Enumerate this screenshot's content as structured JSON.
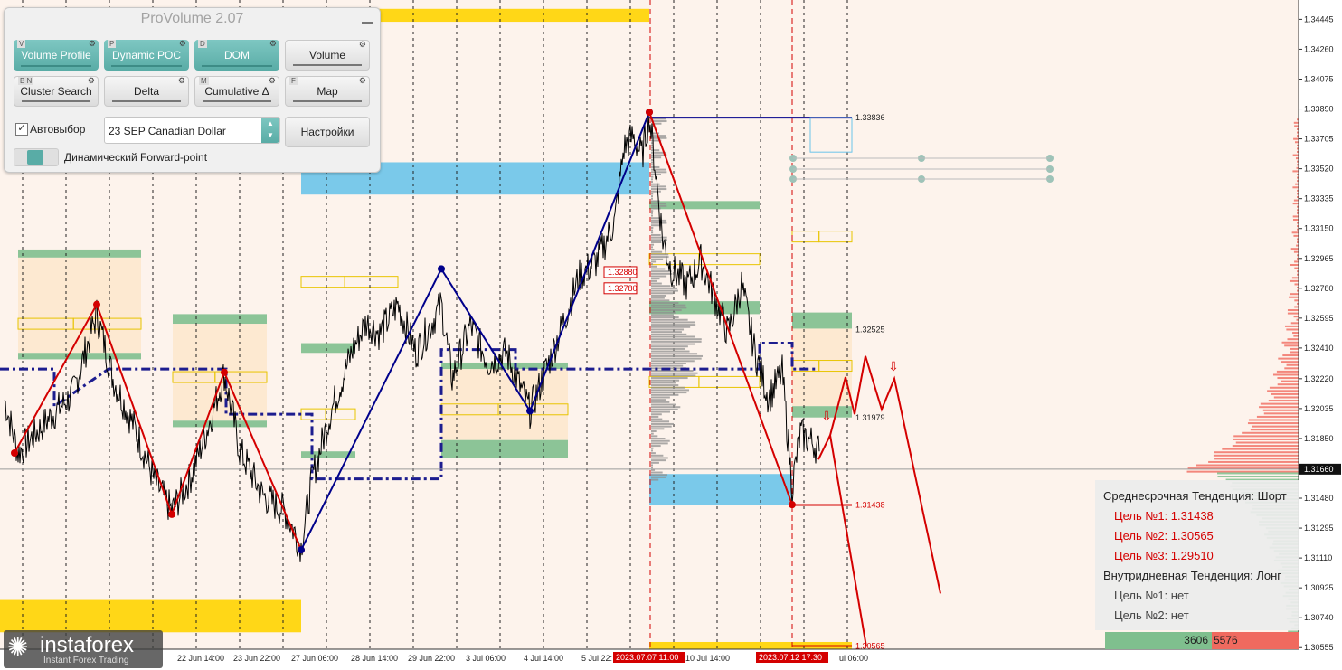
{
  "panel": {
    "title": "ProVolume 2.07",
    "buttons": [
      {
        "key": "V",
        "label": "Volume Profile",
        "style": "teal"
      },
      {
        "key": "P",
        "label": "Dynamic POC",
        "style": "teal"
      },
      {
        "key": "D",
        "label": "DOM",
        "style": "teal"
      },
      {
        "key": "",
        "label": "Volume",
        "style": "gray"
      },
      {
        "key": "B N",
        "label": "Cluster Search",
        "style": "gray"
      },
      {
        "key": "",
        "label": "Delta",
        "style": "gray"
      },
      {
        "key": "M",
        "label": "Cumulative Δ",
        "style": "gray"
      },
      {
        "key": "F",
        "label": "Map",
        "style": "gray"
      }
    ],
    "autoselect_label": "Автовыбор",
    "symbol": "23 SEP Canadian Dollar",
    "settings_label": "Настройки",
    "forward_label": "Динамический Forward-point"
  },
  "info": {
    "mid_title": "Среднесрочная Тенденция: Шорт",
    "mid_targets": [
      "Цель №1: 1.31438",
      "Цель №2: 1.30565",
      "Цель №3: 1.29510"
    ],
    "intra_title": "Внутридневная Тенденция: Лонг",
    "intra_targets": [
      "Цель №1: нет",
      "Цель №2: нет"
    ]
  },
  "volume_bar": {
    "buy": "3606",
    "sell": "5576"
  },
  "logo": {
    "name": "instaforex",
    "sub": "Instant Forex Trading"
  },
  "colors": {
    "background": "#fdf3ec",
    "bull_zone": "#7fbf8e",
    "bear_zone": "#f06a5f",
    "blue_zone": "#6cc4ea",
    "yellow_zone": "#ffd400",
    "zigzag_red": "#d40000",
    "zigzag_blue": "#00008b",
    "dash_level": "#1d1d8f"
  },
  "chart_data": {
    "type": "line",
    "symbol": "23 SEP Canadian Dollar",
    "y_ticks": [
      "1.34445",
      "1.34260",
      "1.34075",
      "1.33890",
      "1.33705",
      "1.33520",
      "1.33335",
      "1.33150",
      "1.32965",
      "1.32780",
      "1.32595",
      "1.32410",
      "1.32220",
      "1.32035",
      "1.31850",
      "1.31660",
      "1.31480",
      "1.31295",
      "1.31110",
      "1.30925",
      "1.30740",
      "1.30555"
    ],
    "ylim": [
      1.3045,
      1.3452
    ],
    "x_labels": [
      "22 Jun 14:00",
      "23 Jun 22:00",
      "27 Jun 06:00",
      "28 Jun 14:00",
      "29 Jun 22:00",
      "3 Jul 06:00",
      "4 Jul 14:00",
      "5 Jul 22:",
      "10 Jul 14:00",
      "ul 06:00"
    ],
    "current_price": "1.31660",
    "price_levels": [
      {
        "label": "1.33836",
        "value": 1.33836
      },
      {
        "label": "1.32525",
        "value": 1.32525
      },
      {
        "label": "1.31979",
        "value": 1.31979
      },
      {
        "label": "1.31438",
        "value": 1.31438
      },
      {
        "label": "1.30565",
        "value": 1.30565
      },
      {
        "label": "1.32880",
        "value": 1.3288
      },
      {
        "label": "1.32780",
        "value": 1.3278
      }
    ],
    "time_markers": [
      "2023.07.07 11:00",
      "2023.07.12 17:30"
    ],
    "zigzag_red": [
      {
        "t": 16,
        "p": 1.3176
      },
      {
        "t": 107,
        "p": 1.3268
      },
      {
        "t": 190,
        "p": 1.3138
      },
      {
        "t": 248,
        "p": 1.3226
      },
      {
        "t": 333,
        "p": 1.3116
      }
    ],
    "zigzag_blue": [
      {
        "t": 333,
        "p": 1.3116
      },
      {
        "t": 488,
        "p": 1.329
      },
      {
        "t": 586,
        "p": 1.3202
      },
      {
        "t": 718,
        "p": 1.3387
      }
    ],
    "zigzag_red_2": [
      {
        "t": 718,
        "p": 1.3387
      },
      {
        "t": 876,
        "p": 1.3144
      }
    ],
    "forecast": [
      {
        "t": 905,
        "p": 1.3172
      },
      {
        "t": 918,
        "p": 1.3187
      },
      {
        "t": 935,
        "p": 1.3223
      },
      {
        "t": 945,
        "p": 1.32
      },
      {
        "t": 957,
        "p": 1.3236
      },
      {
        "t": 975,
        "p": 1.3203
      },
      {
        "t": 989,
        "p": 1.3222
      },
      {
        "t": 1040,
        "p": 1.3089
      }
    ],
    "forecast_2": [
      {
        "t": 918,
        "p": 1.3187
      },
      {
        "t": 958,
        "p": 1.3056
      }
    ],
    "price_anchors": [
      {
        "t": 5,
        "p": 1.3209
      },
      {
        "t": 20,
        "p": 1.3176
      },
      {
        "t": 50,
        "p": 1.3195
      },
      {
        "t": 80,
        "p": 1.3212
      },
      {
        "t": 107,
        "p": 1.3262
      },
      {
        "t": 125,
        "p": 1.3222
      },
      {
        "t": 150,
        "p": 1.319
      },
      {
        "t": 170,
        "p": 1.316
      },
      {
        "t": 190,
        "p": 1.314
      },
      {
        "t": 210,
        "p": 1.316
      },
      {
        "t": 230,
        "p": 1.3192
      },
      {
        "t": 248,
        "p": 1.3225
      },
      {
        "t": 265,
        "p": 1.3178
      },
      {
        "t": 290,
        "p": 1.315
      },
      {
        "t": 315,
        "p": 1.314
      },
      {
        "t": 333,
        "p": 1.3118
      },
      {
        "t": 345,
        "p": 1.316
      },
      {
        "t": 365,
        "p": 1.32
      },
      {
        "t": 390,
        "p": 1.324
      },
      {
        "t": 405,
        "p": 1.3257
      },
      {
        "t": 420,
        "p": 1.325
      },
      {
        "t": 440,
        "p": 1.3268
      },
      {
        "t": 460,
        "p": 1.3238
      },
      {
        "t": 488,
        "p": 1.3268
      },
      {
        "t": 500,
        "p": 1.3222
      },
      {
        "t": 520,
        "p": 1.3255
      },
      {
        "t": 540,
        "p": 1.3232
      },
      {
        "t": 560,
        "p": 1.3238
      },
      {
        "t": 586,
        "p": 1.3202
      },
      {
        "t": 600,
        "p": 1.3222
      },
      {
        "t": 620,
        "p": 1.3252
      },
      {
        "t": 640,
        "p": 1.3285
      },
      {
        "t": 660,
        "p": 1.3295
      },
      {
        "t": 680,
        "p": 1.332
      },
      {
        "t": 690,
        "p": 1.3365
      },
      {
        "t": 700,
        "p": 1.3372
      },
      {
        "t": 710,
        "p": 1.336
      },
      {
        "t": 718,
        "p": 1.3385
      },
      {
        "t": 725,
        "p": 1.335
      },
      {
        "t": 733,
        "p": 1.3308
      },
      {
        "t": 742,
        "p": 1.329
      },
      {
        "t": 760,
        "p": 1.328
      },
      {
        "t": 775,
        "p": 1.3295
      },
      {
        "t": 790,
        "p": 1.3273
      },
      {
        "t": 805,
        "p": 1.325
      },
      {
        "t": 820,
        "p": 1.328
      },
      {
        "t": 835,
        "p": 1.3238
      },
      {
        "t": 850,
        "p": 1.321
      },
      {
        "t": 865,
        "p": 1.3226
      },
      {
        "t": 876,
        "p": 1.3155
      },
      {
        "t": 885,
        "p": 1.3188
      },
      {
        "t": 900,
        "p": 1.3182
      },
      {
        "t": 906,
        "p": 1.3177
      }
    ],
    "zones": [
      {
        "kind": "green",
        "x": [
          20,
          156
        ],
        "p": [
          1.3302,
          1.3297
        ]
      },
      {
        "kind": "band",
        "x": [
          20,
          156
        ],
        "p": [
          1.3297,
          1.3238
        ]
      },
      {
        "kind": "green",
        "x": [
          20,
          156
        ],
        "p": [
          1.3238,
          1.3234
        ]
      },
      {
        "kind": "green",
        "x": [
          191,
          295
        ],
        "p": [
          1.3262,
          1.3256
        ]
      },
      {
        "kind": "band",
        "x": [
          191,
          295
        ],
        "p": [
          1.3256,
          1.3196
        ]
      },
      {
        "kind": "green",
        "x": [
          191,
          295
        ],
        "p": [
          1.3196,
          1.3192
        ]
      },
      {
        "kind": "green",
        "x": [
          333,
          393
        ],
        "p": [
          1.3244,
          1.3238
        ]
      },
      {
        "kind": "green",
        "x": [
          333,
          393
        ],
        "p": [
          1.3177,
          1.3173
        ]
      },
      {
        "kind": "green",
        "x": [
          488,
          628
        ],
        "p": [
          1.3232,
          1.3228
        ]
      },
      {
        "kind": "band",
        "x": [
          488,
          628
        ],
        "p": [
          1.3228,
          1.3184
        ]
      },
      {
        "kind": "green",
        "x": [
          488,
          628
        ],
        "p": [
          1.3184,
          1.3173
        ]
      },
      {
        "kind": "blue",
        "x": [
          333,
          718
        ],
        "p": [
          1.3356,
          1.3336
        ]
      },
      {
        "kind": "yellow",
        "x": [
          333,
          718
        ],
        "p": [
          1.3451,
          1.3443
        ]
      },
      {
        "kind": "yellow",
        "x": [
          0,
          333
        ],
        "p": [
          1.3085,
          1.3065
        ]
      },
      {
        "kind": "green",
        "x": [
          718,
          840
        ],
        "p": [
          1.3332,
          1.3327
        ]
      },
      {
        "kind": "green",
        "x": [
          718,
          840
        ],
        "p": [
          1.327,
          1.3262
        ]
      },
      {
        "kind": "blue",
        "x": [
          718,
          876
        ],
        "p": [
          1.3163,
          1.3144
        ]
      },
      {
        "kind": "green",
        "x": [
          876,
          942
        ],
        "p": [
          1.3263,
          1.3253
        ]
      },
      {
        "kind": "band",
        "x": [
          876,
          942
        ],
        "p": [
          1.3253,
          1.3205
        ]
      },
      {
        "kind": "green",
        "x": [
          876,
          942
        ],
        "p": [
          1.3205,
          1.3198
        ]
      },
      {
        "kind": "yellow",
        "x": [
          718,
          942
        ],
        "p": [
          1.3059,
          1.3054
        ]
      }
    ],
    "poc_boxes": [
      {
        "x": [
          20,
          156
        ],
        "p": 1.3256
      },
      {
        "x": [
          191,
          295
        ],
        "p": 1.3223
      },
      {
        "x": [
          333,
          440
        ],
        "p": 1.3282
      },
      {
        "x": [
          333,
          393
        ],
        "p": 1.32
      },
      {
        "x": [
          488,
          628
        ],
        "p": 1.3203
      },
      {
        "x": [
          718,
          840
        ],
        "p": 1.3296
      },
      {
        "x": [
          718,
          840
        ],
        "p": 1.322
      },
      {
        "x": [
          876,
          942
        ],
        "p": 1.331
      },
      {
        "x": [
          876,
          942
        ],
        "p": 1.323
      }
    ]
  }
}
